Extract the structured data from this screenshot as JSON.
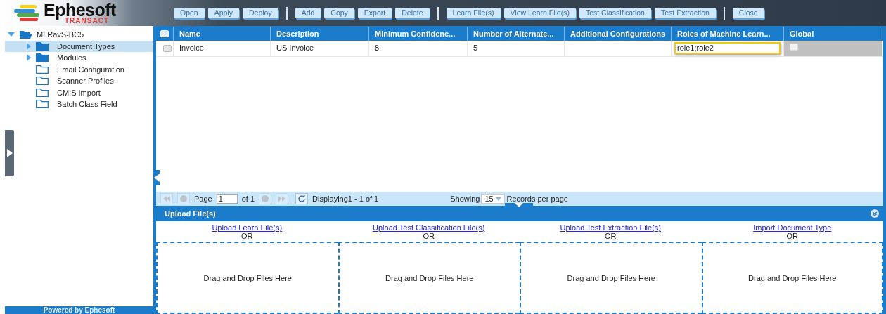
{
  "logo": {
    "name": "Ephesoft",
    "tagline": "TRANSACT"
  },
  "toolbar": [
    [
      "Open",
      "Apply",
      "Deploy"
    ],
    [
      "Add",
      "Copy",
      "Export",
      "Delete"
    ],
    [
      "Learn File(s)",
      "View Learn File(s)",
      "Test Classification",
      "Test Extraction"
    ],
    [
      "Close"
    ]
  ],
  "tree": {
    "label": "MLRavS-BC5",
    "expanded": true,
    "children": [
      {
        "label": "Document Types",
        "kind": "group",
        "selected": true
      },
      {
        "label": "Modules",
        "kind": "group",
        "selected": false
      },
      {
        "label": "Email Configuration",
        "kind": "leaf",
        "selected": false
      },
      {
        "label": "Scanner Profiles",
        "kind": "leaf",
        "selected": false
      },
      {
        "label": "CMIS Import",
        "kind": "leaf",
        "selected": false
      },
      {
        "label": "Batch Class Field",
        "kind": "leaf",
        "selected": false
      }
    ]
  },
  "table": {
    "columns": [
      "Name",
      "Description",
      "Minimum Confidenc...",
      "Number of Alternate...",
      "Additional Configurations",
      "Roles of Machine Learn...",
      "Global"
    ],
    "all_checked": false,
    "rows": [
      {
        "checked": false,
        "cells": [
          {
            "text": "Invoice",
            "editing": false
          },
          {
            "text": "US Invoice",
            "editing": false
          },
          {
            "text": "8",
            "editing": false
          },
          {
            "text": "5",
            "editing": false
          },
          {
            "text": "",
            "editing": false
          },
          {
            "text": "role1;role2",
            "editing": true
          }
        ],
        "global": false
      }
    ]
  },
  "pager": {
    "page_label": "Page",
    "page": "1",
    "of": "of 1",
    "displaying": "Displaying1 - 1 of 1",
    "showing": "Showing",
    "page_size": "15",
    "records": "Records per page"
  },
  "upload": {
    "title": "Upload File(s)",
    "zones": [
      {
        "link": "Upload Learn File(s)",
        "or": "OR",
        "drop": "Drag and Drop Files Here"
      },
      {
        "link": "Upload Test Classification File(s)",
        "or": "OR",
        "drop": "Drag and Drop Files Here"
      },
      {
        "link": "Upload Test Extraction File(s)",
        "or": "OR",
        "drop": "Drag and Drop Files Here"
      },
      {
        "link": "Import Document Type",
        "or": "OR",
        "drop": "Drag and Drop Files Here"
      }
    ]
  },
  "footer": "Powered by Ephesoft"
}
